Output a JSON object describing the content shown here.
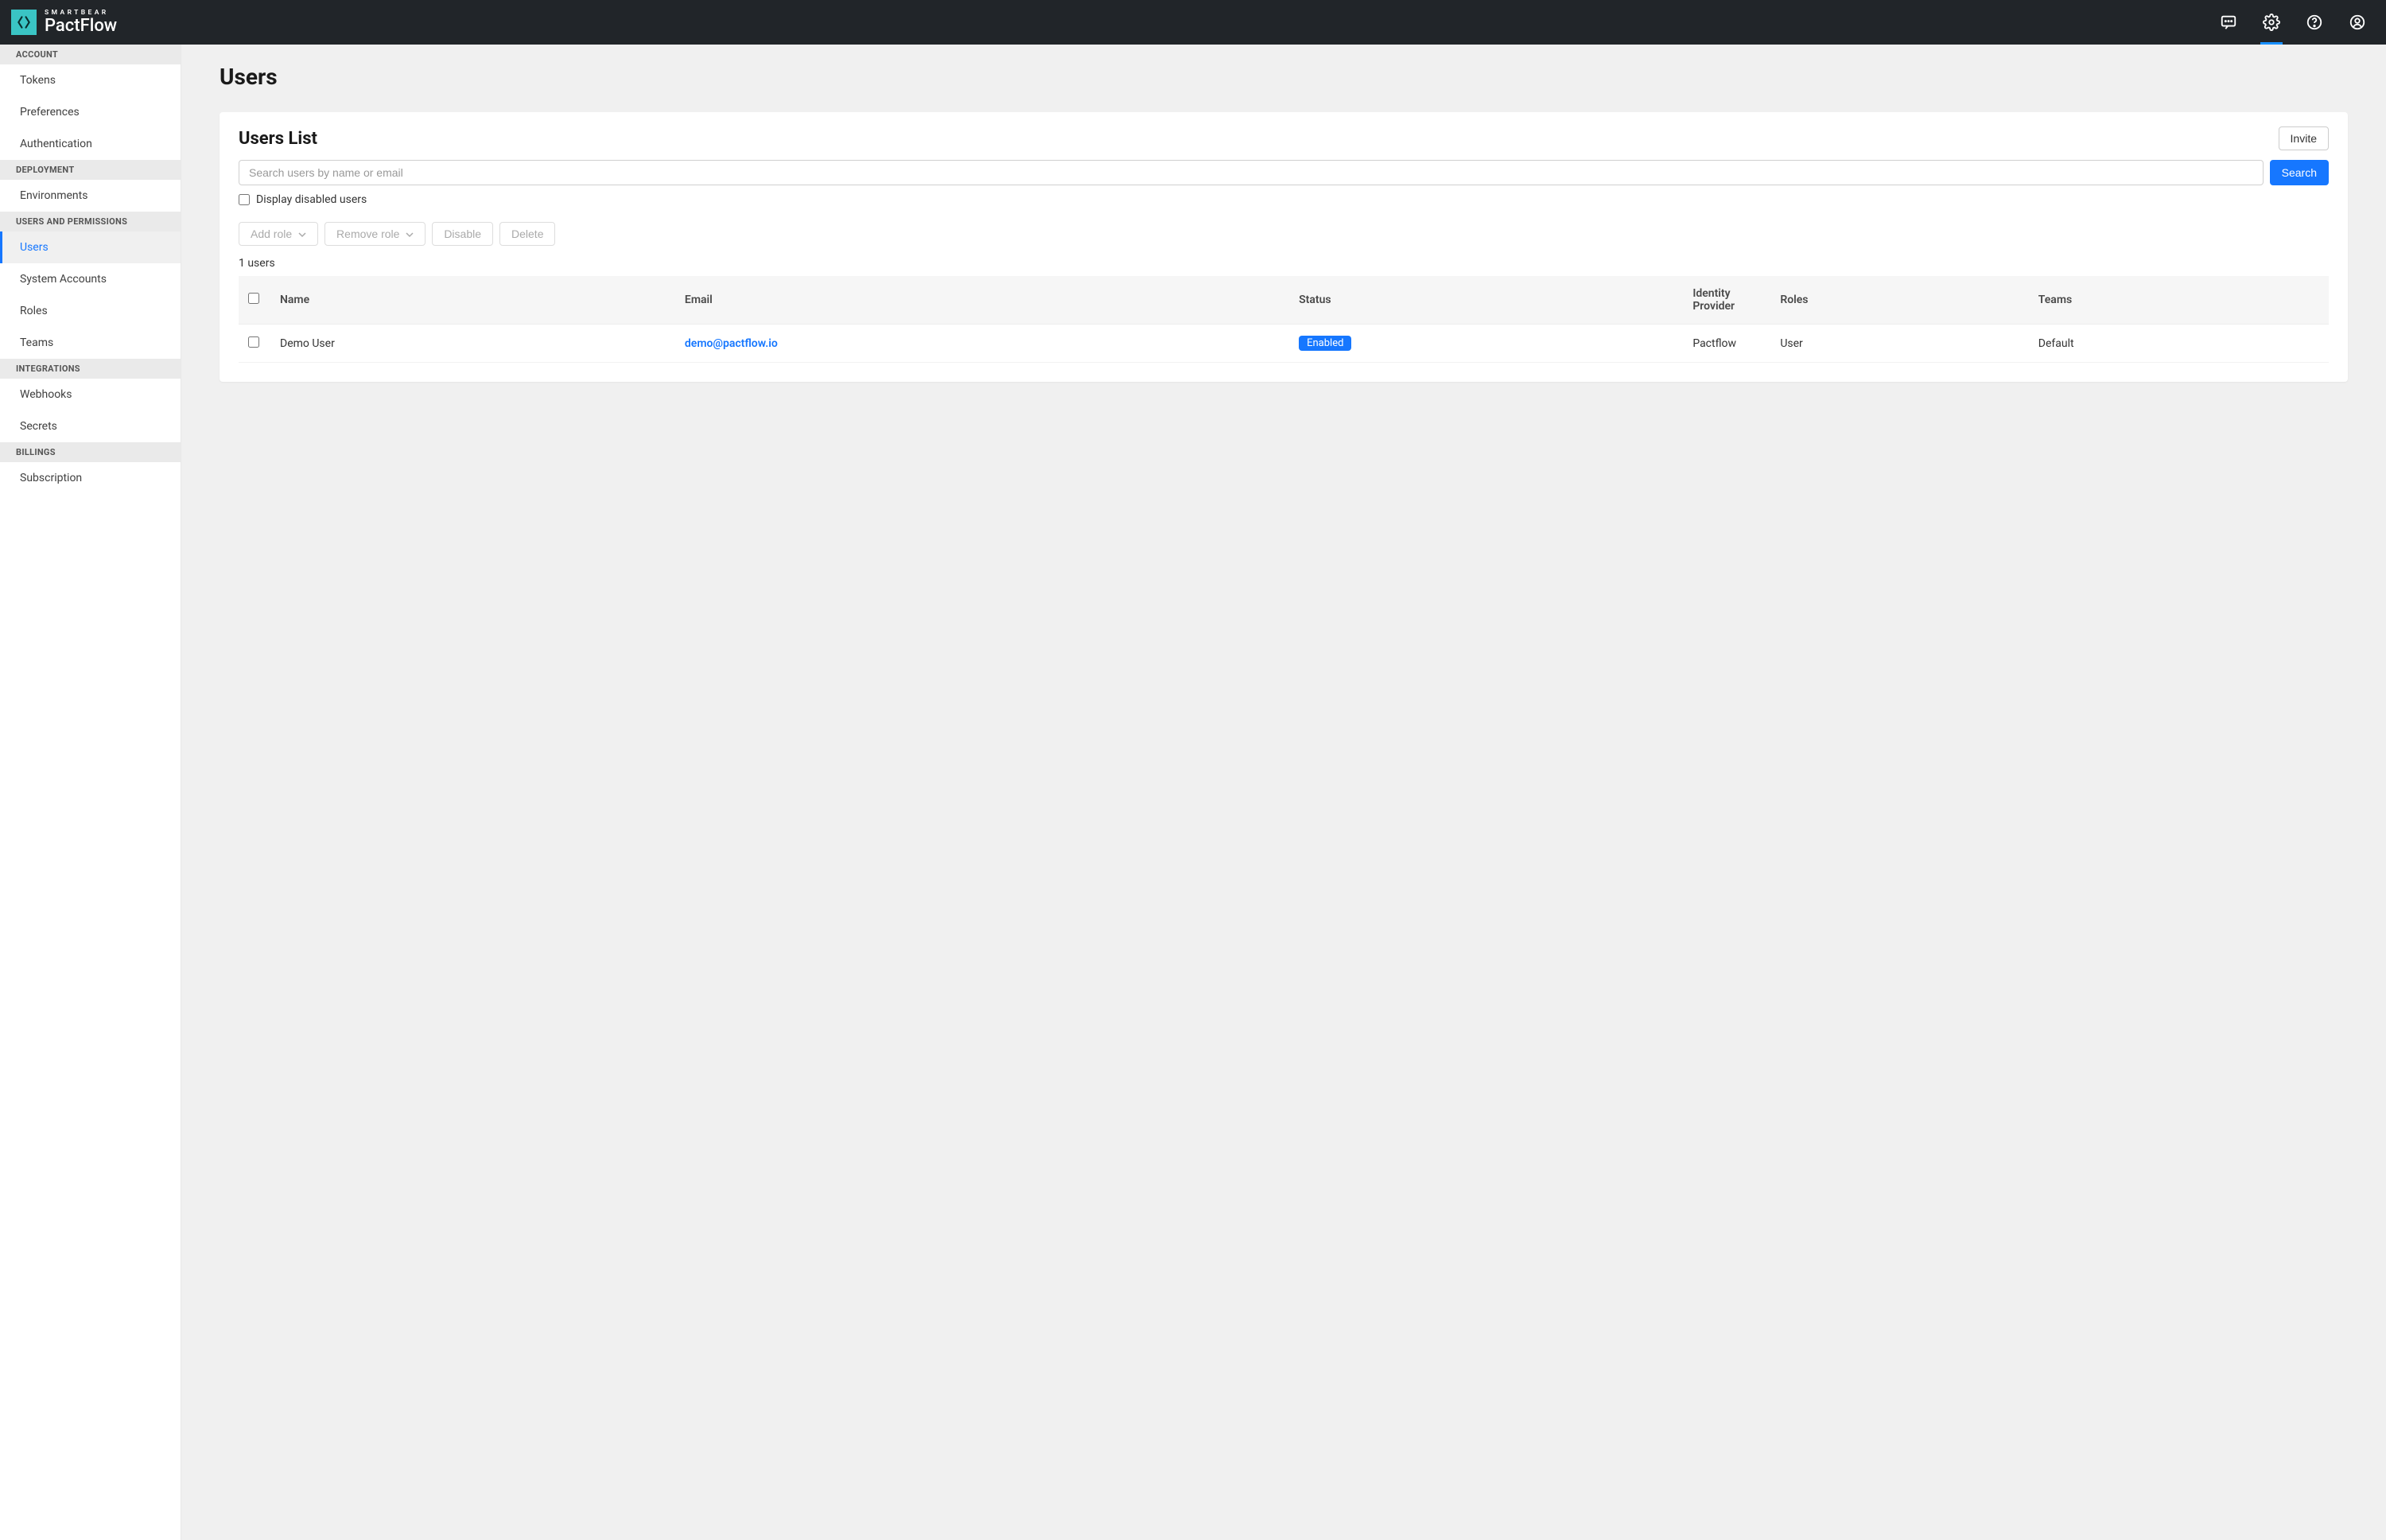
{
  "brand": {
    "small": "SMARTBEAR",
    "big": "PactFlow"
  },
  "sidebar": {
    "sections": [
      {
        "label": "ACCOUNT",
        "items": [
          "Tokens",
          "Preferences",
          "Authentication"
        ]
      },
      {
        "label": "DEPLOYMENT",
        "items": [
          "Environments"
        ]
      },
      {
        "label": "USERS AND PERMISSIONS",
        "items": [
          "Users",
          "System Accounts",
          "Roles",
          "Teams"
        ]
      },
      {
        "label": "INTEGRATIONS",
        "items": [
          "Webhooks",
          "Secrets"
        ]
      },
      {
        "label": "BILLINGS",
        "items": [
          "Subscription"
        ]
      }
    ],
    "active": "Users"
  },
  "page": {
    "title": "Users",
    "card_title": "Users List",
    "invite_label": "Invite",
    "search_placeholder": "Search users by name or email",
    "search_button": "Search",
    "display_disabled_label": "Display disabled users",
    "actions": {
      "add_role": "Add role",
      "remove_role": "Remove role",
      "disable": "Disable",
      "delete": "Delete"
    },
    "count_text": "1 users"
  },
  "table": {
    "headers": {
      "name": "Name",
      "email": "Email",
      "status": "Status",
      "idp": "Identity Provider",
      "roles": "Roles",
      "teams": "Teams"
    },
    "rows": [
      {
        "name": "Demo User",
        "email": "demo@pactflow.io",
        "status": "Enabled",
        "idp": "Pactflow",
        "roles": "User",
        "teams": "Default"
      }
    ]
  }
}
